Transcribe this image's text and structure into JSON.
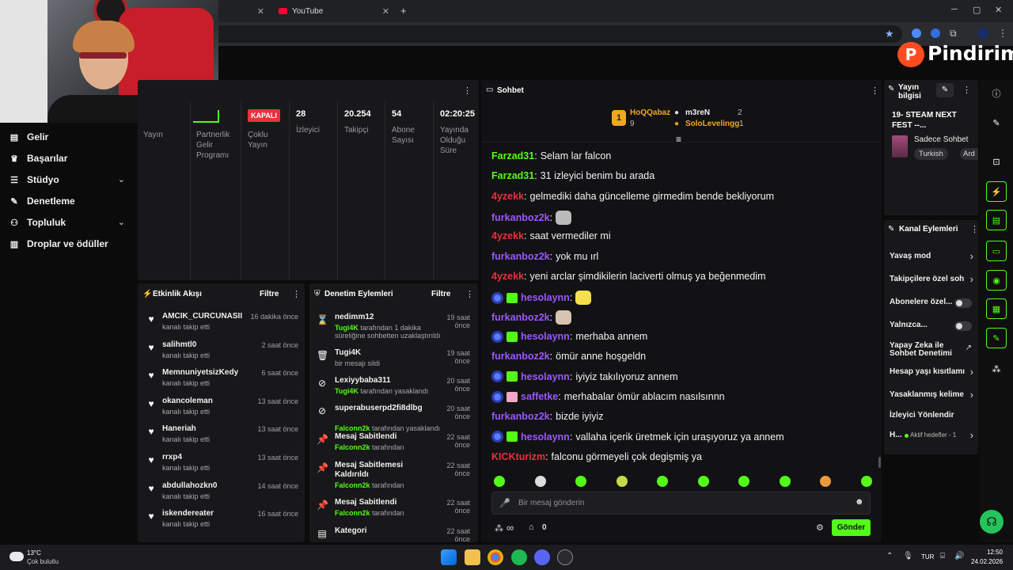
{
  "browser": {
    "tab1_title": "",
    "tab2_title": "YouTube",
    "new_tab": "+",
    "min": "─",
    "max": "▢",
    "close": "✕"
  },
  "brand": {
    "name": "Pindirim",
    "logo_letter": "P"
  },
  "leftnav": {
    "items": [
      {
        "label": "Gelir",
        "icon": "▤"
      },
      {
        "label": "Başarılar",
        "icon": "🏆"
      },
      {
        "label": "Stüdyo",
        "icon": "☰",
        "chevron": true
      },
      {
        "label": "Denetleme",
        "icon": "🔧"
      },
      {
        "label": "Topluluk",
        "icon": "👥",
        "chevron": true
      },
      {
        "label": "Droplar ve ödüller",
        "icon": "▥"
      }
    ]
  },
  "stats": {
    "items": [
      {
        "value": "",
        "label": "Yayın"
      },
      {
        "value": "",
        "label": "Partnerlik Gelir Programı"
      },
      {
        "value": "KAPALI",
        "label": "Çoklu Yayın"
      },
      {
        "value": "28",
        "label": "İzleyici"
      },
      {
        "value": "20.254",
        "label": "Takipçi"
      },
      {
        "value": "54",
        "label": "Abone Sayısı"
      },
      {
        "value": "02:20:25",
        "label": "Yayında Olduğu Süre"
      }
    ]
  },
  "activity": {
    "title": "Etkinlik Akışı",
    "filter": "Filtre",
    "items": [
      {
        "name": "AMCIK_CURCUNASII",
        "sub": "kanalı takip etti",
        "time": "16 dakika önce"
      },
      {
        "name": "salihmtl0",
        "sub": "kanalı takip etti",
        "time": "2 saat önce"
      },
      {
        "name": "MemnuniyetsizKedy",
        "sub": "kanalı takip etti",
        "time": "6 saat önce"
      },
      {
        "name": "okancoleman",
        "sub": "kanalı takip etti",
        "time": "13 saat önce"
      },
      {
        "name": "Haneriah",
        "sub": "kanalı takip etti",
        "time": "13 saat önce"
      },
      {
        "name": "rrxp4",
        "sub": "kanalı takip etti",
        "time": "13 saat önce"
      },
      {
        "name": "abdullahozkn0",
        "sub": "kanalı takip etti",
        "time": "14 saat önce"
      },
      {
        "name": "iskendereater",
        "sub": "kanalı takip etti",
        "time": "16 saat önce"
      }
    ]
  },
  "moderation": {
    "title": "Denetim Eylemleri",
    "filter": "Filtre",
    "items": [
      {
        "icon": "⌛",
        "name": "nedimm12",
        "actor": "Tugi4K",
        "rest": " tarafından 1 dakika süreliğine sohbetten uzaklaştırıldı",
        "time": "19 saat önce"
      },
      {
        "icon": "🗑",
        "name": "Tugi4K",
        "actor": "",
        "rest": "bir mesajı sildi",
        "time": "19 saat önce"
      },
      {
        "icon": "⊘",
        "name": "Lexiyybaba311",
        "actor": "Tugi4K",
        "rest": " tarafından yasaklandı",
        "time": "20 saat önce"
      },
      {
        "icon": "⊘",
        "name": "superabuserpd2fi8dlbg",
        "actor": "Falconn2k",
        "rest": " tarafından yasaklandı",
        "time": "20 saat önce"
      },
      {
        "icon": "📌",
        "name": "Mesaj Sabitlendi",
        "actor": "Falconn2k",
        "rest": " tarafından",
        "time": "22 saat önce"
      },
      {
        "icon": "📌",
        "name": "Mesaj Sabitlemesi Kaldırıldı",
        "actor": "Falconn2k",
        "rest": " tarafından",
        "time": "22 saat önce"
      },
      {
        "icon": "📌",
        "name": "Mesaj Sabitlendi",
        "actor": "Falconn2k",
        "rest": " tarafından",
        "time": "22 saat önce"
      },
      {
        "icon": "▤",
        "name": "Kategori",
        "actor": "",
        "rest": "",
        "time": "22 saat önce"
      }
    ]
  },
  "chat": {
    "title": "Sohbet",
    "leaders": [
      {
        "rank": "1",
        "name": "HoQQabaz",
        "count": "9"
      },
      {
        "name": "m3reN",
        "count": "2"
      },
      {
        "name": "SoloLevelingg",
        "count": "1"
      }
    ],
    "messages": [
      {
        "user": "Farzad31",
        "color": "#53fc18",
        "text": "Selam lar falcon"
      },
      {
        "user": "Farzad31",
        "color": "#53fc18",
        "text": "31 izleyici benim bu arada"
      },
      {
        "user": "4yzekk",
        "color": "#e8323c",
        "text": "gelmediki daha güncelleme girmedim bende bekliyorum"
      },
      {
        "user": "furkanboz2k",
        "color": "#9b57ff",
        "text": "",
        "emote": "#bbb"
      },
      {
        "user": "4yzekk",
        "color": "#e8323c",
        "text": "saat vermediler mi"
      },
      {
        "user": "furkanboz2k",
        "color": "#9b57ff",
        "text": "yok mu ırl"
      },
      {
        "user": "4yzekk",
        "color": "#e8323c",
        "text": "yeni arclar şimdikilerin laciverti olmuş ya beğenmedim"
      },
      {
        "user": "hesolaynn",
        "color": "#9b57ff",
        "text": "",
        "badges": true,
        "emote": "#f4e04d"
      },
      {
        "user": "furkanboz2k",
        "color": "#9b57ff",
        "text": "",
        "emote": "#d8c3b0"
      },
      {
        "user": "hesolaynn",
        "color": "#9b57ff",
        "text": "merhaba annem",
        "badges": true
      },
      {
        "user": "furkanboz2k",
        "color": "#9b57ff",
        "text": "ömür anne hoşgeldn"
      },
      {
        "user": "hesolaynn",
        "color": "#9b57ff",
        "text": "iyiyiz takılıyoruz annem",
        "badges": true
      },
      {
        "user": "saffetke",
        "color": "#9b57ff",
        "text": "merhabalar ömür ablacım nasılsınnn",
        "badges": true,
        "pink": true
      },
      {
        "user": "furkanboz2k",
        "color": "#9b57ff",
        "text": "bizde iyiyiz"
      },
      {
        "user": "hesolaynn",
        "color": "#9b57ff",
        "text": "vallaha içerik üretmek için uraşıyoruz ya annem",
        "badges": true
      },
      {
        "user": "KICKturizm",
        "color": "#e8323c",
        "text": "falconu görmeyeli çok degişmiş ya"
      }
    ],
    "input_placeholder": "Bir mesaj gönderin",
    "points": "∞",
    "store_count": "0",
    "send": "Gönder"
  },
  "stream_info": {
    "title": "Yayın bilgisi",
    "stream_title": "19- STEAM NEXT FEST --...",
    "category": "Sadece Sohbet",
    "tags": [
      "Turkish",
      "Ard"
    ]
  },
  "channel_actions": {
    "title": "Kanal Eylemleri",
    "items": [
      {
        "label": "Yavaş mod",
        "type": "chev"
      },
      {
        "label": "Takipçilere özel soh",
        "type": "chev"
      },
      {
        "label": "Abonelere özel...",
        "type": "toggle"
      },
      {
        "label": "Yalnızca...",
        "type": "toggle"
      },
      {
        "label": "Yapay Zeka ile Sohbet Denetimi",
        "type": "ext"
      },
      {
        "label": "Hesap yaşı kısıtlamı",
        "type": "chev"
      },
      {
        "label": "Yasaklanmış kelime",
        "type": "chev"
      },
      {
        "label": "İzleyici Yönlendir",
        "type": "none"
      },
      {
        "label": "H...",
        "type": "goal",
        "goal": "Aktif hedefler - 1"
      }
    ]
  },
  "taskbar": {
    "temp": "13°C",
    "weather": "Çok bulutlu",
    "lang": "TUR",
    "time": "12:50",
    "date": "24.02.2026"
  },
  "colors": {
    "accent": "#53fc18",
    "danger": "#e8323c",
    "purple": "#9b57ff"
  }
}
